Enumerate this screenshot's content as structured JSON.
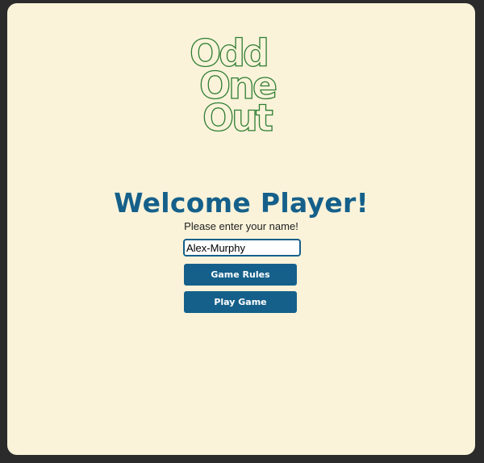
{
  "logo": {
    "line1": "Odd",
    "line2": "One",
    "line3": "Out"
  },
  "welcome": {
    "title": "Welcome Player!",
    "prompt": "Please enter your name!"
  },
  "name_input": {
    "value": "Alex-Murphy"
  },
  "buttons": {
    "rules_label": "Game Rules",
    "play_label": "Play Game"
  },
  "colors": {
    "background": "#faf3da",
    "accent": "#15608a",
    "logo_stroke": "#2e7d32"
  }
}
